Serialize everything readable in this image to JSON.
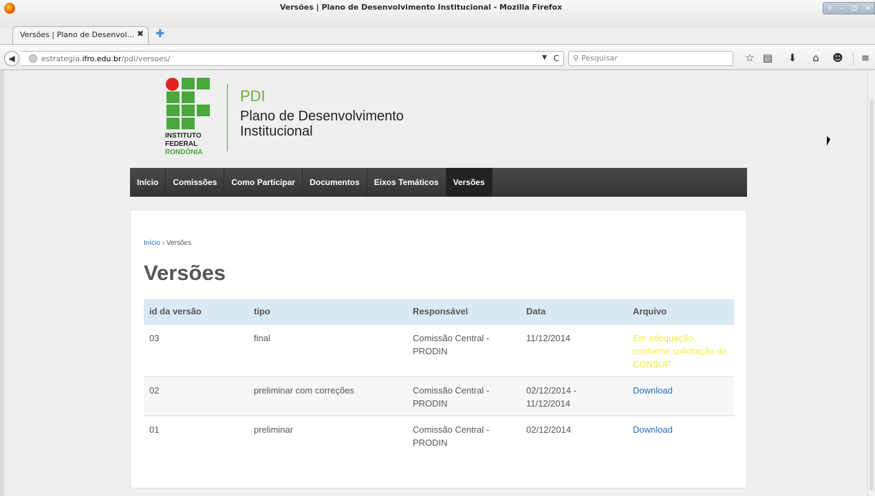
{
  "window": {
    "title": "Versões | Plano de Desenvolvimento Institucional - Mozilla Firefox",
    "controls": [
      "⇧",
      "–",
      "⊡",
      "✕"
    ]
  },
  "tab": {
    "label": "Versões | Plano de Desenvol...",
    "close": "✖"
  },
  "newtab_icon": "✚",
  "address": {
    "prefix": "estrategia.",
    "host": "ifro.edu.br",
    "path": "/pdi/versoes/",
    "drop": "▼",
    "reload": "C"
  },
  "search": {
    "placeholder": "Pesquisar"
  },
  "toolbar_icons": {
    "bookmark": "☆",
    "reading_list": "▤",
    "download": "⬇",
    "home": "⌂",
    "chat": "☻",
    "menu": "≡"
  },
  "logo": {
    "line1": "INSTITUTO",
    "line2": "FEDERAL",
    "line3": "RONDÔNIA",
    "colors": {
      "green": "#4aa73d",
      "red": "#e42020"
    }
  },
  "header": {
    "title": "PDI",
    "subtitle": "Plano de Desenvolvimento Institucional"
  },
  "menu": {
    "items": [
      {
        "label": "Início"
      },
      {
        "label": "Comissões"
      },
      {
        "label": "Como Participar"
      },
      {
        "label": "Documentos"
      },
      {
        "label": "Eixos Temáticos"
      },
      {
        "label": "Versões",
        "active": true
      }
    ]
  },
  "breadcrumb": {
    "home": "Início",
    "separator": "›",
    "current": "Versões"
  },
  "page_title": "Versões",
  "table": {
    "headers": [
      "id da versão",
      "tipo",
      "Responsável",
      "Data",
      "Arquivo"
    ],
    "rows": [
      {
        "id": "03",
        "tipo": "final",
        "responsavel": "Comissão Central - PRODIN",
        "data": "11/12/2014",
        "arquivo": "Em adequação, conforme solicitação do CONSUP"
      },
      {
        "id": "02",
        "tipo": "preliminar com correções",
        "responsavel": "Comissão Central - PRODIN",
        "data": "02/12/2014 - 11/12/2014",
        "arquivo": "Download"
      },
      {
        "id": "01",
        "tipo": "preliminar",
        "responsavel": "Comissão Central - PRODIN",
        "data": "02/12/2014",
        "arquivo": "Download"
      }
    ]
  },
  "colors": {
    "link": "#1f6fbf",
    "pending_text": "#eeee44",
    "table_header_bg": "#d9eaf5",
    "menu_bg": "#3b3b3b",
    "title_green": "#6fae3a"
  }
}
